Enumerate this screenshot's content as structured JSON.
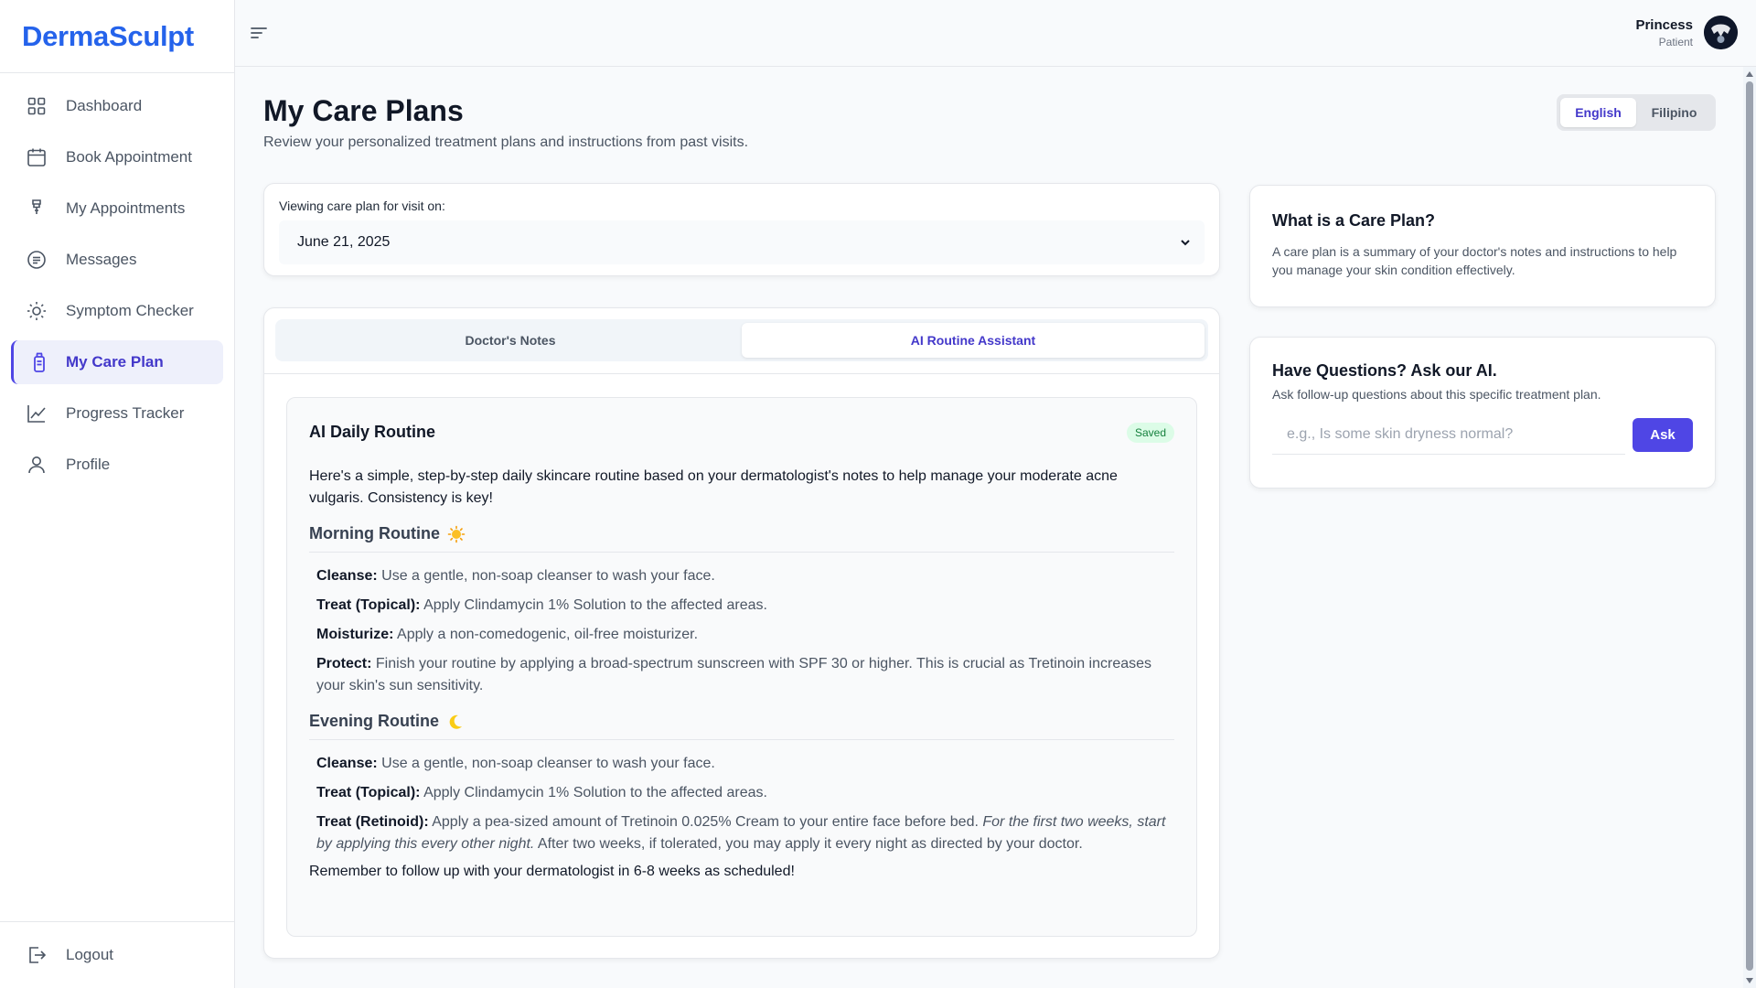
{
  "app": {
    "brand": "DermaSculpt",
    "accent": "#4f46e5",
    "brand_color": "#2563eb"
  },
  "sidebar": {
    "items": [
      {
        "label": "Dashboard",
        "icon": "grid-icon",
        "active": false
      },
      {
        "label": "Book Appointment",
        "icon": "calendar-icon",
        "active": false
      },
      {
        "label": "My Appointments",
        "icon": "clipboard-icon",
        "active": false
      },
      {
        "label": "Messages",
        "icon": "message-icon",
        "active": false
      },
      {
        "label": "Symptom Checker",
        "icon": "sun-icon",
        "active": false
      },
      {
        "label": "My Care Plan",
        "icon": "bottle-icon",
        "active": true
      },
      {
        "label": "Progress Tracker",
        "icon": "chart-line-icon",
        "active": false
      },
      {
        "label": "Profile",
        "icon": "user-icon",
        "active": false
      }
    ],
    "logout": "Logout"
  },
  "user": {
    "name": "Princess",
    "role": "Patient"
  },
  "page": {
    "title": "My Care Plans",
    "subtitle": "Review your personalized treatment plans and instructions from past visits."
  },
  "language": {
    "options": [
      "English",
      "Filipino"
    ],
    "selected": "English"
  },
  "visit": {
    "label": "Viewing care plan for visit on:",
    "selected": "June 21, 2025"
  },
  "tabs": {
    "items": [
      "Doctor's Notes",
      "AI Routine Assistant"
    ],
    "active": "AI Routine Assistant"
  },
  "routine": {
    "title": "AI Daily Routine",
    "badge": "Saved",
    "intro": "Here's a simple, step-by-step daily skincare routine based on your dermatologist's notes to help manage your moderate acne vulgaris. Consistency is key!",
    "morning": {
      "heading": "Morning Routine",
      "emoji": "sun-icon",
      "steps": [
        {
          "label": "Cleanse:",
          "text": "Use a gentle, non-soap cleanser to wash your face."
        },
        {
          "label": "Treat (Topical):",
          "text": "Apply Clindamycin 1% Solution to the affected areas."
        },
        {
          "label": "Moisturize:",
          "text": "Apply a non-comedogenic, oil-free moisturizer."
        },
        {
          "label": "Protect:",
          "text": "Finish your routine by applying a broad-spectrum sunscreen with SPF 30 or higher. This is crucial as Tretinoin increases your skin's sun sensitivity."
        }
      ]
    },
    "evening": {
      "heading": "Evening Routine",
      "emoji": "moon-icon",
      "steps": [
        {
          "label": "Cleanse:",
          "text": "Use a gentle, non-soap cleanser to wash your face."
        },
        {
          "label": "Treat (Topical):",
          "text": "Apply Clindamycin 1% Solution to the affected areas."
        }
      ],
      "retinoid": {
        "label": "Treat (Retinoid):",
        "text_before": "Apply a pea-sized amount of Tretinoin 0.025% Cream to your entire face before bed.",
        "text_italic": "For the first two weeks, start by applying this every other night.",
        "text_after": "After two weeks, if tolerated, you may apply it every night as directed by your doctor."
      }
    },
    "outro": "Remember to follow up with your dermatologist in 6-8 weeks as scheduled!"
  },
  "info": {
    "title": "What is a Care Plan?",
    "text": "A care plan is a summary of your doctor's notes and instructions to help you manage your skin condition effectively."
  },
  "ask": {
    "title": "Have Questions? Ask our AI.",
    "subtitle": "Ask follow-up questions about this specific treatment plan.",
    "placeholder": "e.g., Is some skin dryness normal?",
    "value": "",
    "button": "Ask"
  }
}
